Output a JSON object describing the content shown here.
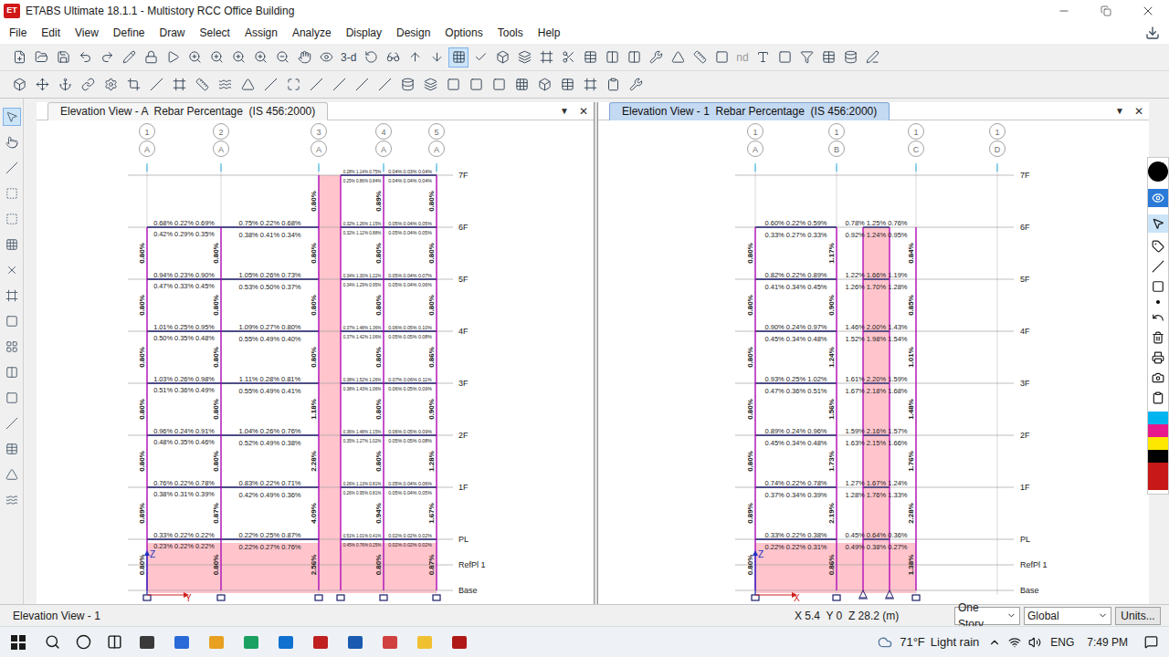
{
  "window": {
    "logo": "ET",
    "title": "ETABS Ultimate 18.1.1 - Multistory RCC Office Building"
  },
  "menu": [
    "File",
    "Edit",
    "View",
    "Define",
    "Draw",
    "Select",
    "Assign",
    "Analyze",
    "Display",
    "Design",
    "Options",
    "Tools",
    "Help"
  ],
  "toolbar": {
    "texts": [
      "3-d",
      "nd"
    ]
  },
  "tool_strip": {
    "items": [
      {
        "selected": true
      },
      {
        "selected": false
      },
      {
        "selected": false
      },
      {
        "selected": false
      },
      {
        "selected": false
      },
      {
        "selected": false
      },
      {
        "selected": false
      },
      {
        "selected": false
      },
      {
        "selected": false
      },
      {
        "selected": false
      },
      {
        "selected": false
      },
      {
        "selected": false
      },
      {
        "selected": false
      },
      {
        "selected": false
      },
      {
        "selected": false
      },
      {
        "selected": false
      }
    ]
  },
  "views": [
    {
      "title": "Elevation View - A  Rebar Percentage  (IS 456:2000)",
      "active": false,
      "menu_glyph": "▼",
      "close_glyph": "✕",
      "grids": [
        {
          "top": "1",
          "bottom": "A"
        },
        {
          "top": "2",
          "bottom": "A"
        },
        {
          "top": "3",
          "bottom": "A"
        },
        {
          "top": "4",
          "bottom": "A"
        },
        {
          "top": "5",
          "bottom": "A"
        }
      ],
      "stories": [
        {
          "name": "7F",
          "failed": false
        },
        {
          "name": "6F",
          "failed": false
        },
        {
          "name": "5F",
          "failed": false
        },
        {
          "name": "4F",
          "failed": false
        },
        {
          "name": "3F",
          "failed": false
        },
        {
          "name": "2F",
          "failed": false
        },
        {
          "name": "1F",
          "failed": false
        },
        {
          "name": "PL",
          "failed": true
        },
        {
          "name": "RefPl 1",
          "failed": false
        },
        {
          "name": "Base",
          "failed": false
        }
      ],
      "bays": [
        {
          "failed": false
        },
        {
          "failed": false
        },
        {
          "failed": true
        },
        {
          "failed": false
        },
        {
          "failed": false
        }
      ],
      "supports": [
        {
          "kind": "fixed"
        },
        {
          "kind": "fixed"
        },
        {
          "kind": "fixed"
        },
        {
          "kind": "fixed"
        },
        {
          "kind": "fixed"
        },
        {
          "kind": "fixed"
        }
      ],
      "axes": {
        "vertical": "Z",
        "horizontal": "Y"
      },
      "beams": [
        {
          "story": "6F",
          "bay": 0,
          "top": "0.68% 0.22% 0.69%",
          "bottom": "0.42% 0.29% 0.35%"
        },
        {
          "story": "5F",
          "bay": 0,
          "top": "0.94% 0.23% 0.90%",
          "bottom": "0.47% 0.33% 0.45%"
        },
        {
          "story": "4F",
          "bay": 0,
          "top": "1.01% 0.25% 0.95%",
          "bottom": "0.50% 0.35% 0.48%"
        },
        {
          "story": "3F",
          "bay": 0,
          "top": "1.03% 0.26% 0.98%",
          "bottom": "0.51% 0.36% 0.49%"
        },
        {
          "story": "2F",
          "bay": 0,
          "top": "0.96% 0.24% 0.91%",
          "bottom": "0.48% 0.35% 0.46%"
        },
        {
          "story": "1F",
          "bay": 0,
          "top": "0.76% 0.22% 0.78%",
          "bottom": "0.38% 0.31% 0.39%"
        },
        {
          "story": "PL",
          "bay": 0,
          "top": "0.33% 0.22% 0.22%",
          "bottom": "0.23% 0.22% 0.22%"
        },
        {
          "story": "6F",
          "bay": 1,
          "top": "0.75% 0.22% 0.68%",
          "bottom": "0.38% 0.41% 0.34%"
        },
        {
          "story": "5F",
          "bay": 1,
          "top": "1.05% 0.26% 0.73%",
          "bottom": "0.53% 0.50% 0.37%"
        },
        {
          "story": "4F",
          "bay": 1,
          "top": "1.09% 0.27% 0.80%",
          "bottom": "0.55% 0.49% 0.40%"
        },
        {
          "story": "3F",
          "bay": 1,
          "top": "1.11% 0.28% 0.81%",
          "bottom": "0.55% 0.49% 0.41%"
        },
        {
          "story": "2F",
          "bay": 1,
          "top": "1.04% 0.26% 0.76%",
          "bottom": "0.52% 0.49% 0.38%"
        },
        {
          "story": "1F",
          "bay": 1,
          "top": "0.83% 0.22% 0.71%",
          "bottom": "0.42% 0.49% 0.36%"
        },
        {
          "story": "PL",
          "bay": 1,
          "top": "0.22% 0.25% 0.87%",
          "bottom": "0.22% 0.27% 0.76%"
        },
        {
          "story": "7F",
          "bay": 3,
          "top": "0.28% 1.14% 0.75%",
          "bottom": "0.25% 0.86% 0.84%"
        },
        {
          "story": "6F",
          "bay": 3,
          "top": "0.32% 1.26% 1.15%",
          "bottom": "0.32% 1.12% 0.88%"
        },
        {
          "story": "5F",
          "bay": 3,
          "top": "0.34% 1.30% 1.22%",
          "bottom": "0.34% 1.29% 0.95%"
        },
        {
          "story": "4F",
          "bay": 3,
          "top": "0.37% 1.48% 1.36%",
          "bottom": "0.37% 1.42% 1.06%"
        },
        {
          "story": "3F",
          "bay": 3,
          "top": "0.38% 1.52% 1.26%",
          "bottom": "0.38% 1.43% 1.06%"
        },
        {
          "story": "2F",
          "bay": 3,
          "top": "0.36% 1.48% 1.15%",
          "bottom": "0.35% 1.27% 1.02%"
        },
        {
          "story": "1F",
          "bay": 3,
          "top": "0.26% 1.13% 0.81%",
          "bottom": "0.26% 0.95% 0.81%"
        },
        {
          "story": "PL",
          "bay": 3,
          "top": "0.51% 1.01% 0.41%",
          "bottom": "0.45% 0.76% 0.25%"
        },
        {
          "story": "7F",
          "bay": 4,
          "top": "0.04% 0.03% 0.04%",
          "bottom": "0.04% 0.04% 0.04%"
        },
        {
          "story": "6F",
          "bay": 4,
          "top": "0.05% 0.04% 0.05%",
          "bottom": "0.05% 0.04% 0.05%"
        },
        {
          "story": "5F",
          "bay": 4,
          "top": "0.05% 0.04% 0.07%",
          "bottom": "0.05% 0.04% 0.06%"
        },
        {
          "story": "4F",
          "bay": 4,
          "top": "0.06% 0.05% 0.10%",
          "bottom": "0.05% 0.05% 0.08%"
        },
        {
          "story": "3F",
          "bay": 4,
          "top": "0.07% 0.06% 0.11%",
          "bottom": "0.06% 0.05% 0.09%"
        },
        {
          "story": "2F",
          "bay": 4,
          "top": "0.06% 0.05% 0.09%",
          "bottom": "0.05% 0.05% 0.08%"
        },
        {
          "story": "1F",
          "bay": 4,
          "top": "0.05% 0.04% 0.06%",
          "bottom": "0.05% 0.04% 0.05%"
        },
        {
          "story": "PL",
          "bay": 4,
          "top": "0.02% 0.02% 0.02%",
          "bottom": "0.02% 0.02% 0.02%"
        }
      ],
      "columns": [
        {
          "line": 2,
          "from": "7F",
          "to": "6F",
          "text": "0.80%"
        },
        {
          "line": 4,
          "from": "7F",
          "to": "6F",
          "text": "0.89%"
        },
        {
          "line": 5,
          "from": "7F",
          "to": "6F",
          "text": "0.80%"
        },
        {
          "line": 0,
          "from": "6F",
          "to": "5F",
          "text": "0.80%"
        },
        {
          "line": 1,
          "from": "6F",
          "to": "5F",
          "text": "0.80%"
        },
        {
          "line": 2,
          "from": "6F",
          "to": "5F",
          "text": "0.80%"
        },
        {
          "line": 4,
          "from": "6F",
          "to": "5F",
          "text": "0.80%"
        },
        {
          "line": 5,
          "from": "6F",
          "to": "5F",
          "text": "0.80%"
        },
        {
          "line": 0,
          "from": "5F",
          "to": "4F",
          "text": "0.80%"
        },
        {
          "line": 1,
          "from": "5F",
          "to": "4F",
          "text": "0.80%"
        },
        {
          "line": 2,
          "from": "5F",
          "to": "4F",
          "text": "0.80%"
        },
        {
          "line": 4,
          "from": "5F",
          "to": "4F",
          "text": "0.80%"
        },
        {
          "line": 5,
          "from": "5F",
          "to": "4F",
          "text": "0.80%"
        },
        {
          "line": 0,
          "from": "4F",
          "to": "3F",
          "text": "0.80%"
        },
        {
          "line": 1,
          "from": "4F",
          "to": "3F",
          "text": "0.80%"
        },
        {
          "line": 2,
          "from": "4F",
          "to": "3F",
          "text": "0.80%"
        },
        {
          "line": 4,
          "from": "4F",
          "to": "3F",
          "text": "0.80%"
        },
        {
          "line": 5,
          "from": "4F",
          "to": "3F",
          "text": "0.86%"
        },
        {
          "line": 0,
          "from": "3F",
          "to": "2F",
          "text": "0.80%"
        },
        {
          "line": 1,
          "from": "3F",
          "to": "2F",
          "text": "0.80%"
        },
        {
          "line": 2,
          "from": "3F",
          "to": "2F",
          "text": "1.18%"
        },
        {
          "line": 4,
          "from": "3F",
          "to": "2F",
          "text": "0.80%"
        },
        {
          "line": 5,
          "from": "3F",
          "to": "2F",
          "text": "0.90%"
        },
        {
          "line": 0,
          "from": "2F",
          "to": "1F",
          "text": "0.80%"
        },
        {
          "line": 1,
          "from": "2F",
          "to": "1F",
          "text": "0.80%"
        },
        {
          "line": 2,
          "from": "2F",
          "to": "1F",
          "text": "2.28%"
        },
        {
          "line": 4,
          "from": "2F",
          "to": "1F",
          "text": "0.80%"
        },
        {
          "line": 5,
          "from": "2F",
          "to": "1F",
          "text": "1.28%"
        },
        {
          "line": 0,
          "from": "1F",
          "to": "PL",
          "text": "0.89%"
        },
        {
          "line": 1,
          "from": "1F",
          "to": "PL",
          "text": "0.87%"
        },
        {
          "line": 2,
          "from": "1F",
          "to": "PL",
          "text": "4.09%"
        },
        {
          "line": 4,
          "from": "1F",
          "to": "PL",
          "text": "0.94%"
        },
        {
          "line": 5,
          "from": "1F",
          "to": "PL",
          "text": "1.67%"
        },
        {
          "line": 0,
          "from": "PL",
          "to": "Base",
          "text": "0.80%"
        },
        {
          "line": 1,
          "from": "PL",
          "to": "Base",
          "text": "0.80%"
        },
        {
          "line": 2,
          "from": "PL",
          "to": "Base",
          "text": "2.56%"
        },
        {
          "line": 4,
          "from": "PL",
          "to": "Base",
          "text": "0.80%"
        },
        {
          "line": 5,
          "from": "PL",
          "to": "Base",
          "text": "0.87%"
        }
      ]
    },
    {
      "title": "Elevation View - 1  Rebar Percentage  (IS 456:2000)",
      "active": true,
      "menu_glyph": "▼",
      "close_glyph": "✕",
      "grids": [
        {
          "top": "1",
          "bottom": "A"
        },
        {
          "top": "1",
          "bottom": "B"
        },
        {
          "top": "1",
          "bottom": "C"
        },
        {
          "top": "1",
          "bottom": "D"
        }
      ],
      "stories": [
        {
          "name": "7F",
          "failed": false
        },
        {
          "name": "6F",
          "failed": false
        },
        {
          "name": "5F",
          "failed": false
        },
        {
          "name": "4F",
          "failed": false
        },
        {
          "name": "3F",
          "failed": false
        },
        {
          "name": "2F",
          "failed": false
        },
        {
          "name": "1F",
          "failed": false
        },
        {
          "name": "PL",
          "failed": true
        },
        {
          "name": "RefPl 1",
          "failed": false
        },
        {
          "name": "Base",
          "failed": false
        }
      ],
      "bays": [
        {
          "failed": false
        },
        {
          "failed": false
        },
        {
          "failed": true
        },
        {
          "failed": false
        }
      ],
      "supports": [
        {
          "kind": "fixed"
        },
        {
          "kind": "fixed"
        },
        {
          "kind": "pinned"
        },
        {
          "kind": "pinned"
        },
        {
          "kind": "fixed"
        }
      ],
      "axes": {
        "vertical": "Z",
        "horizontal": "X"
      },
      "beams": [
        {
          "story": "6F",
          "bay": 0,
          "top": "0.60% 0.22% 0.59%",
          "bottom": "0.33% 0.27% 0.33%"
        },
        {
          "story": "5F",
          "bay": 0,
          "top": "0.82% 0.22% 0.89%",
          "bottom": "0.41% 0.34% 0.45%"
        },
        {
          "story": "4F",
          "bay": 0,
          "top": "0.90% 0.24% 0.97%",
          "bottom": "0.45% 0.34% 0.48%"
        },
        {
          "story": "3F",
          "bay": 0,
          "top": "0.93% 0.25% 1.02%",
          "bottom": "0.47% 0.36% 0.51%"
        },
        {
          "story": "2F",
          "bay": 0,
          "top": "0.89% 0.24% 0.96%",
          "bottom": "0.45% 0.34% 0.48%"
        },
        {
          "story": "1F",
          "bay": 0,
          "top": "0.74% 0.22% 0.78%",
          "bottom": "0.37% 0.34% 0.39%"
        },
        {
          "story": "PL",
          "bay": 0,
          "top": "0.33% 0.22% 0.38%",
          "bottom": "0.22% 0.22% 0.31%"
        },
        {
          "story": "6F",
          "bay": 2,
          "top": "0.78% 1.25% 0.76%",
          "bottom": "0.92% 1.24% 0.95%"
        },
        {
          "story": "5F",
          "bay": 2,
          "top": "1.22% 1.66% 1.19%",
          "bottom": "1.26% 1.70% 1.28%"
        },
        {
          "story": "4F",
          "bay": 2,
          "top": "1.46% 2.00% 1.43%",
          "bottom": "1.52% 1.98% 1.54%"
        },
        {
          "story": "3F",
          "bay": 2,
          "top": "1.61% 2.20% 1.59%",
          "bottom": "1.67% 2.18% 1.68%"
        },
        {
          "story": "2F",
          "bay": 2,
          "top": "1.59% 2.16% 1.57%",
          "bottom": "1.63% 2.15% 1.66%"
        },
        {
          "story": "1F",
          "bay": 2,
          "top": "1.27% 1.67% 1.24%",
          "bottom": "1.28% 1.76% 1.33%"
        },
        {
          "story": "PL",
          "bay": 2,
          "top": "0.45% 0.64% 0.36%",
          "bottom": "0.49% 0.38% 0.27%"
        }
      ],
      "columns": [
        {
          "line": 0,
          "from": "6F",
          "to": "5F",
          "text": "0.80%"
        },
        {
          "line": 1,
          "from": "6F",
          "to": "5F",
          "text": "1.17%"
        },
        {
          "line": 4,
          "from": "6F",
          "to": "5F",
          "text": "0.84%"
        },
        {
          "line": 0,
          "from": "5F",
          "to": "4F",
          "text": "0.80%"
        },
        {
          "line": 1,
          "from": "5F",
          "to": "4F",
          "text": "0.90%"
        },
        {
          "line": 4,
          "from": "5F",
          "to": "4F",
          "text": "0.85%"
        },
        {
          "line": 0,
          "from": "4F",
          "to": "3F",
          "text": "0.80%"
        },
        {
          "line": 1,
          "from": "4F",
          "to": "3F",
          "text": "1.24%"
        },
        {
          "line": 4,
          "from": "4F",
          "to": "3F",
          "text": "1.01%"
        },
        {
          "line": 0,
          "from": "3F",
          "to": "2F",
          "text": "0.80%"
        },
        {
          "line": 1,
          "from": "3F",
          "to": "2F",
          "text": "1.56%"
        },
        {
          "line": 4,
          "from": "3F",
          "to": "2F",
          "text": "1.48%"
        },
        {
          "line": 0,
          "from": "2F",
          "to": "1F",
          "text": "0.80%"
        },
        {
          "line": 1,
          "from": "2F",
          "to": "1F",
          "text": "1.73%"
        },
        {
          "line": 4,
          "from": "2F",
          "to": "1F",
          "text": "1.76%"
        },
        {
          "line": 0,
          "from": "1F",
          "to": "PL",
          "text": "0.89%"
        },
        {
          "line": 1,
          "from": "1F",
          "to": "PL",
          "text": "2.19%"
        },
        {
          "line": 4,
          "from": "1F",
          "to": "PL",
          "text": "2.28%"
        },
        {
          "line": 0,
          "from": "PL",
          "to": "Base",
          "text": "0.80%"
        },
        {
          "line": 1,
          "from": "PL",
          "to": "Base",
          "text": "0.86%"
        },
        {
          "line": 4,
          "from": "PL",
          "to": "Base",
          "text": "1.38%"
        }
      ]
    }
  ],
  "status_bar": {
    "view": "Elevation View - 1",
    "coords": "X 5.4  Y 0  Z 28.2 (m)",
    "story_mode": "One Story",
    "coord_system": "Global",
    "units": "Units..."
  },
  "taskbar": {
    "temperature": "71°F",
    "weather": "Light rain",
    "language": "ENG",
    "time": "7:49 PM"
  }
}
